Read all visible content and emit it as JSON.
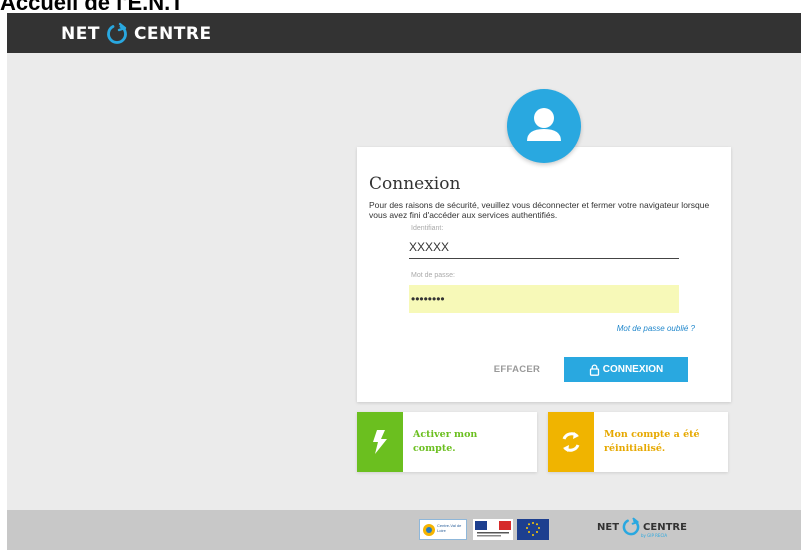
{
  "doc_title": "Accueil de l'E.N.T",
  "brand": {
    "left": "NET",
    "right": "CENTRE",
    "ring_color": "#29a8e0"
  },
  "login": {
    "title": "Connexion",
    "notice": "Pour des raisons de sécurité, veuillez vous déconnecter et fermer votre navigateur lorsque vous avez fini d'accéder aux services authentifiés.",
    "identifier_label": "Identifiant:",
    "identifier_value": "XXXXX",
    "password_label": "Mot de passe:",
    "password_value": "••••••••",
    "forgot_link": "Mot de passe oublié ?",
    "clear_button": "EFFACER",
    "connect_button": "CONNEXION"
  },
  "tiles": {
    "activate": "Activer mon compte.",
    "reset": "Mon compte a été réinitialisé."
  },
  "footer": {
    "region_logo_text": "Centre-Val de Loire",
    "brand_left": "NET",
    "brand_right": "CENTRE",
    "brand_sub": "by GIP RECIA"
  },
  "colors": {
    "accent": "#29a8e0",
    "topbar": "#333333",
    "activate": "#6bbf1f",
    "reset": "#f0b400",
    "autofill": "#f7f9b8"
  },
  "icons": [
    "net-centre-ring-icon",
    "user-icon",
    "lock-icon",
    "lightning-icon",
    "refresh-icon",
    "eu-flag-icon",
    "french-republic-logo"
  ]
}
